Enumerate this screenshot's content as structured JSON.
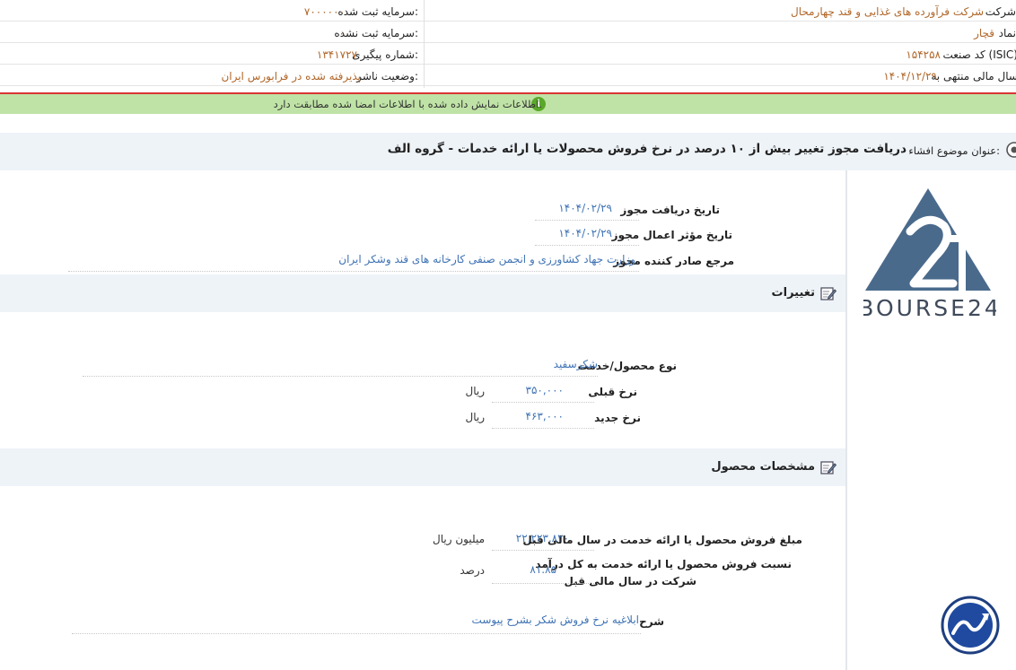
{
  "header": {
    "company_label": "شرکت:",
    "company_value": "شرکت فرآورده های غذایی و قند چهارمحال",
    "symbol_label": "نماد:",
    "symbol_value": "قچار",
    "isic_label": "کد صنعت (ISIC):",
    "isic_value": "۱۵۴۲۵۸",
    "fiscal_label": "سال مالی منتهی به:",
    "fiscal_value": "۱۴۰۴/۱۲/۲۹",
    "capital_label": "سرمایه ثبت شده:",
    "capital_value": "۷۰۰۰۰۰۰",
    "unreg_capital_label": "سرمایه ثبت نشده:",
    "unreg_capital_value": "۰",
    "tracking_label": "شماره پیگیری:",
    "tracking_value": "۱۳۴۱۷۲۷",
    "status_label": "وضعیت ناشر:",
    "status_value": "پذیرفته شده در فرابورس ایران"
  },
  "notice": {
    "text": "اطلاعات نمایش داده شده با اطلاعات امضا شده مطابقت دارد.",
    "icon": "info-icon"
  },
  "subject": {
    "label": "عنوان موضوع افشاء:",
    "value": "دریافت مجوز تغییر بیش از ۱۰ درصد در نرخ فروش محصولات یا ارائه خدمات - گروه الف"
  },
  "permit": {
    "receive_date_label": "تاریخ دریافت مجوز",
    "receive_date_value": "۱۴۰۴/۰۲/۲۹",
    "effective_date_label": "تاریخ مؤثر اعمال مجوز",
    "effective_date_value": "۱۴۰۴/۰۲/۲۹",
    "issuer_label": "مرجع صادر کننده مجوز",
    "issuer_value": "وزارت جهاد کشاورزی و انجمن صنفی کارخانه های قند وشکر ایران"
  },
  "changes": {
    "title": "تغییرات",
    "product_label": "نوع محصول/خدمت",
    "product_value": "شکرسفید",
    "old_rate_label": "نرخ قبلی",
    "old_rate_value": "۳۵۰,۰۰۰",
    "old_rate_unit": "ریال",
    "new_rate_label": "نرخ جدید",
    "new_rate_value": "۴۶۳,۰۰۰",
    "new_rate_unit": "ریال"
  },
  "specs": {
    "title": "مشخصات محصول",
    "sales_label": "مبلغ فروش محصول یا ارائه خدمت در سال مالی قبل",
    "sales_value": "۲۲,۲۲۳,۸۲۰",
    "sales_unit": "میلیون ریال",
    "ratio_label_line1": "نسبت فروش محصول یا ارائه خدمت به کل درآمد",
    "ratio_label_line2": "شرکت در سال مالی قبل",
    "ratio_value": "۸۱.۸۵",
    "ratio_unit": "درصد",
    "desc_label": "شرح",
    "desc_value": "ابلاغیه نرخ فروش شکر بشرح پیوست"
  },
  "logo": {
    "text": "BOURSE24",
    "color": "#4a6a8c"
  },
  "colors": {
    "accent_brown": "#b0672a",
    "accent_blue": "#3f73b5",
    "notice_bg": "#bfe3a6",
    "red_line": "#d93434"
  }
}
